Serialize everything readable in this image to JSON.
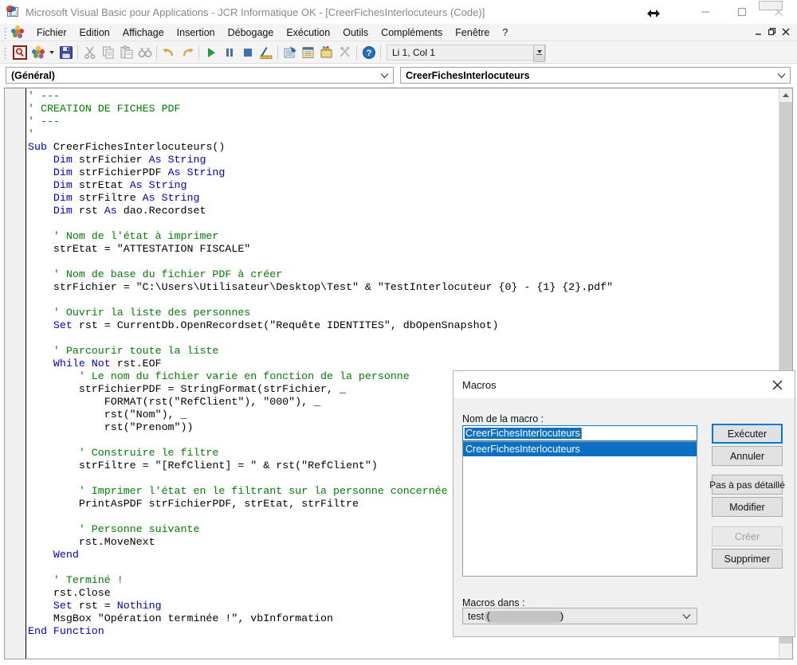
{
  "window": {
    "title": "Microsoft Visual Basic pour Applications - JCR Informatique OK - [CreerFichesInterlocuteurs (Code)]",
    "app_icon": "vba-document-icon",
    "minimize_label": "–",
    "maximize_label": "□",
    "close_label": "✕",
    "cursor": "horizontal-resize-cursor"
  },
  "menubar": {
    "items": [
      {
        "label": "Fichier",
        "accel": "F"
      },
      {
        "label": "Edition",
        "accel": "E"
      },
      {
        "label": "Affichage",
        "accel": "A"
      },
      {
        "label": "Insertion",
        "accel": "I"
      },
      {
        "label": "Débogage",
        "accel": "D"
      },
      {
        "label": "Exécution",
        "accel": "x"
      },
      {
        "label": "Outils",
        "accel": "O"
      },
      {
        "label": "Compléments",
        "accel": "C"
      },
      {
        "label": "Fenêtre",
        "accel": "ê"
      },
      {
        "label": "?",
        "accel": "?"
      }
    ],
    "mdi_buttons": [
      {
        "name": "mdi-minimize",
        "label": "–"
      },
      {
        "name": "mdi-restore",
        "label": "❐"
      },
      {
        "name": "mdi-close",
        "label": "✕"
      }
    ]
  },
  "toolbar": {
    "buttons": [
      {
        "name": "view-microsoft-access-button",
        "icon": "access-key-icon"
      },
      {
        "name": "insert-userform-button",
        "icon": "vba-project-icon"
      },
      {
        "name": "save-button",
        "icon": "floppy-save-icon"
      },
      {
        "name": "cut-button",
        "icon": "scissors-icon"
      },
      {
        "name": "copy-button",
        "icon": "copy-icon"
      },
      {
        "name": "paste-button",
        "icon": "clipboard-paste-icon"
      },
      {
        "name": "find-button",
        "icon": "binoculars-icon"
      },
      {
        "name": "undo-button",
        "icon": "undo-arrow-icon"
      },
      {
        "name": "redo-button",
        "icon": "redo-arrow-icon"
      },
      {
        "name": "run-button",
        "icon": "play-triangle-icon"
      },
      {
        "name": "break-button",
        "icon": "pause-icon"
      },
      {
        "name": "reset-button",
        "icon": "stop-square-icon"
      },
      {
        "name": "design-mode-button",
        "icon": "ruler-pencil-icon"
      },
      {
        "name": "project-explorer-button",
        "icon": "project-explorer-icon"
      },
      {
        "name": "properties-window-button",
        "icon": "properties-window-icon"
      },
      {
        "name": "object-browser-button",
        "icon": "object-browser-icon"
      },
      {
        "name": "toolbox-button",
        "icon": "toolbox-hammer-icon"
      },
      {
        "name": "help-button",
        "icon": "help-question-icon"
      }
    ],
    "status_field": {
      "value": "Li 1, Col 1",
      "name": "line-column-indicator"
    }
  },
  "combobar": {
    "object_combo": {
      "value": "(Général)",
      "name": "object-combo"
    },
    "procedure_combo": {
      "value": "CreerFichesInterlocuteurs",
      "name": "procedure-combo"
    }
  },
  "code": {
    "lines": [
      [
        {
          "t": "'",
          "c": "cm"
        },
        {
          "t": " ---",
          "c": "cm"
        }
      ],
      [
        {
          "t": "' CREATION DE FICHES PDF",
          "c": "cm"
        }
      ],
      [
        {
          "t": "' ---",
          "c": "cm"
        }
      ],
      [
        {
          "t": "'",
          "c": "cm"
        }
      ],
      [
        {
          "t": "Sub",
          "c": "kw"
        },
        {
          "t": " CreerFichesInterlocuteurs()",
          "c": ""
        }
      ],
      [
        {
          "t": "    ",
          "c": ""
        },
        {
          "t": "Dim",
          "c": "kw"
        },
        {
          "t": " strFichier ",
          "c": ""
        },
        {
          "t": "As String",
          "c": "kw"
        }
      ],
      [
        {
          "t": "    ",
          "c": ""
        },
        {
          "t": "Dim",
          "c": "kw"
        },
        {
          "t": " strFichierPDF ",
          "c": ""
        },
        {
          "t": "As String",
          "c": "kw"
        }
      ],
      [
        {
          "t": "    ",
          "c": ""
        },
        {
          "t": "Dim",
          "c": "kw"
        },
        {
          "t": " strEtat ",
          "c": ""
        },
        {
          "t": "As String",
          "c": "kw"
        }
      ],
      [
        {
          "t": "    ",
          "c": ""
        },
        {
          "t": "Dim",
          "c": "kw"
        },
        {
          "t": " strFiltre ",
          "c": ""
        },
        {
          "t": "As String",
          "c": "kw"
        }
      ],
      [
        {
          "t": "    ",
          "c": ""
        },
        {
          "t": "Dim",
          "c": "kw"
        },
        {
          "t": " rst ",
          "c": ""
        },
        {
          "t": "As",
          "c": "kw"
        },
        {
          "t": " dao.Recordset",
          "c": ""
        }
      ],
      [
        {
          "t": "",
          "c": ""
        }
      ],
      [
        {
          "t": "    ' Nom de l'état à imprimer",
          "c": "cm"
        }
      ],
      [
        {
          "t": "    strEtat = \"ATTESTATION FISCALE\"",
          "c": ""
        }
      ],
      [
        {
          "t": "",
          "c": ""
        }
      ],
      [
        {
          "t": "    ' Nom de base du fichier PDF à créer",
          "c": "cm"
        }
      ],
      [
        {
          "t": "    strFichier = \"C:\\Users\\Utilisateur\\Desktop\\Test\" & \"TestInterlocuteur {0} - {1} {2}.pdf\"",
          "c": ""
        }
      ],
      [
        {
          "t": "",
          "c": ""
        }
      ],
      [
        {
          "t": "    ' Ouvrir la liste des personnes",
          "c": "cm"
        }
      ],
      [
        {
          "t": "    ",
          "c": ""
        },
        {
          "t": "Set",
          "c": "kw"
        },
        {
          "t": " rst = CurrentDb.OpenRecordset(\"Requête IDENTITES\", dbOpenSnapshot)",
          "c": ""
        }
      ],
      [
        {
          "t": "",
          "c": ""
        }
      ],
      [
        {
          "t": "    ' Parcourir toute la liste",
          "c": "cm"
        }
      ],
      [
        {
          "t": "    ",
          "c": ""
        },
        {
          "t": "While Not",
          "c": "kw"
        },
        {
          "t": " rst.EOF",
          "c": ""
        }
      ],
      [
        {
          "t": "        ' Le nom du fichier varie en fonction de la personne",
          "c": "cm"
        }
      ],
      [
        {
          "t": "        strFichierPDF = StringFormat(strFichier, _",
          "c": ""
        }
      ],
      [
        {
          "t": "            FORMAT(rst(\"RefClient\"), \"000\"), _",
          "c": ""
        }
      ],
      [
        {
          "t": "            rst(\"Nom\"), _",
          "c": ""
        }
      ],
      [
        {
          "t": "            rst(\"Prenom\"))",
          "c": ""
        }
      ],
      [
        {
          "t": "",
          "c": ""
        }
      ],
      [
        {
          "t": "        ' Construire le filtre",
          "c": "cm"
        }
      ],
      [
        {
          "t": "        strFiltre = \"[RefClient] = \" & rst(\"RefClient\")",
          "c": ""
        }
      ],
      [
        {
          "t": "",
          "c": ""
        }
      ],
      [
        {
          "t": "        ' Imprimer l'état en le filtrant sur la personne concernée",
          "c": "cm"
        }
      ],
      [
        {
          "t": "        PrintAsPDF strFichierPDF, strEtat, strFiltre",
          "c": ""
        }
      ],
      [
        {
          "t": "",
          "c": ""
        }
      ],
      [
        {
          "t": "        ' Personne suivante",
          "c": "cm"
        }
      ],
      [
        {
          "t": "        rst.MoveNext",
          "c": ""
        }
      ],
      [
        {
          "t": "    ",
          "c": ""
        },
        {
          "t": "Wend",
          "c": "kw"
        }
      ],
      [
        {
          "t": "",
          "c": ""
        }
      ],
      [
        {
          "t": "    ' Terminé !",
          "c": "cm"
        }
      ],
      [
        {
          "t": "    rst.Close",
          "c": ""
        }
      ],
      [
        {
          "t": "    ",
          "c": ""
        },
        {
          "t": "Set",
          "c": "kw"
        },
        {
          "t": " rst = ",
          "c": ""
        },
        {
          "t": "Nothing",
          "c": "kw"
        }
      ],
      [
        {
          "t": "    MsgBox \"Opération terminée !\", vbInformation",
          "c": ""
        }
      ],
      [
        {
          "t": "End Function",
          "c": "kw"
        }
      ]
    ]
  },
  "dialog": {
    "title": "Macros",
    "close_label": "✕",
    "macro_name_label": "Nom de la macro :",
    "macro_name_value": "CreerFichesInterlocuteurs",
    "macro_list": [
      {
        "label": "CreerFichesInterlocuteurs",
        "selected": true
      }
    ],
    "macros_in_label": "Macros dans :",
    "macros_in_value": "test (",
    "macros_in_value_suffix": ")",
    "buttons": [
      {
        "name": "execute-button",
        "label": "Exécuter",
        "state": "default"
      },
      {
        "name": "cancel-button",
        "label": "Annuler",
        "state": "normal"
      },
      {
        "name": "step-into-button",
        "label": "Pas à pas détaillé",
        "state": "normal"
      },
      {
        "name": "edit-button",
        "label": "Modifier",
        "state": "normal"
      },
      {
        "name": "create-button",
        "label": "Créer",
        "state": "disabled"
      },
      {
        "name": "delete-button",
        "label": "Supprimer",
        "state": "normal"
      }
    ]
  },
  "colors": {
    "accent": "#0078d7",
    "selection": "#0b6fc4",
    "keyword": "#0000c0",
    "comment": "#008000",
    "dialog_bg": "#f0f0f0",
    "toolbar_bg": "#f4f4f4"
  }
}
